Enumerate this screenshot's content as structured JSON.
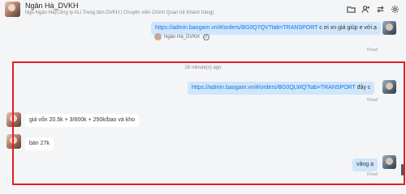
{
  "header": {
    "name": "Ngân Hà_DVKH",
    "subtitle": "Ngô Ngân Hà(Công ty ALi Trung tâm DVKH | Chuyên viên Chính Quan hệ Khách hàng)",
    "icons": [
      "folder-icon",
      "add-user-icon",
      "transfer-icon",
      "settings-icon"
    ]
  },
  "messages": {
    "m1": {
      "link": "https://admin.baogam.vn/#/orders/BG0Q7QV?tab=TRANSPORT",
      "text": " c ơi xn giá giúp e với ạ",
      "tag": "Ngân Hà_DVKH",
      "read": "Read"
    },
    "timestamp": "26 minute(s) ago",
    "m2": {
      "link": "https://admin.baogam.vn/#/orders/BG0QLWQ?tab=TRANSPORT",
      "text": " đây c",
      "read": "Read"
    },
    "m3": {
      "text": "giá vốn 20.5k + 3/600k + 250k/bao và kho"
    },
    "m4": {
      "text": "bán 27k"
    },
    "m5": {
      "text": "vâng ạ",
      "read": "Read"
    }
  }
}
